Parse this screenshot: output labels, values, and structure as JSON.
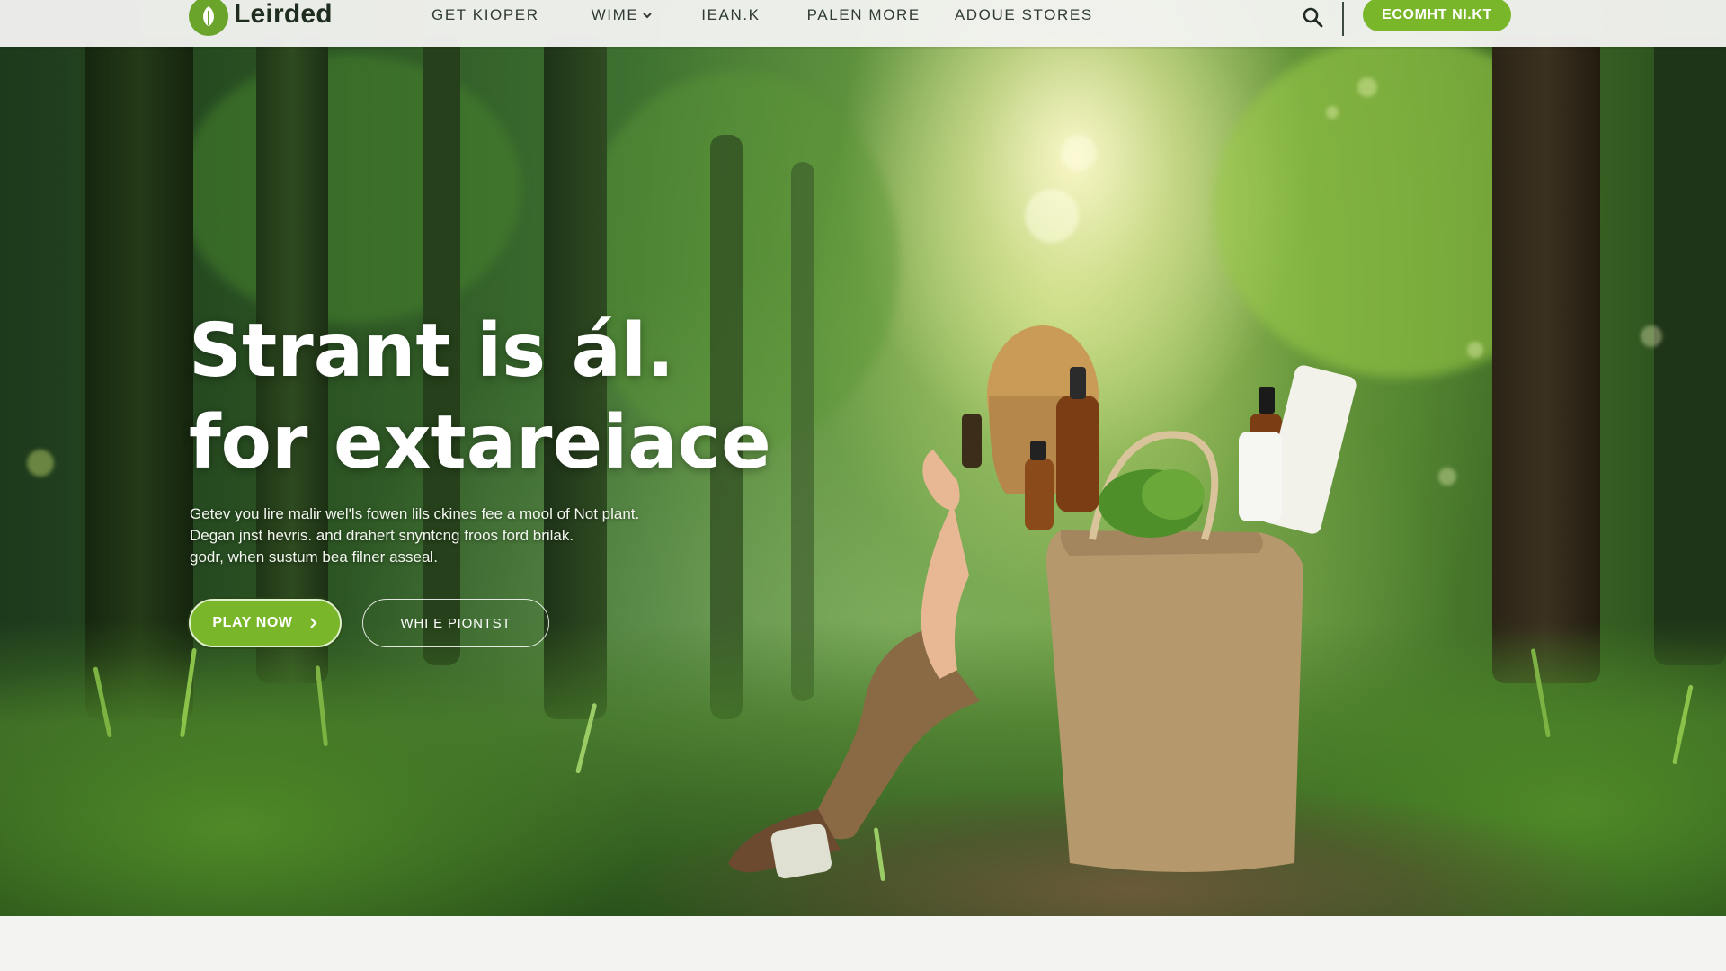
{
  "brand": {
    "name": "Leirded",
    "logo_icon": "leaf-icon",
    "accent_color": "#79b62a"
  },
  "nav": {
    "items": [
      {
        "label": "GET KIOPER",
        "has_dropdown": false
      },
      {
        "label": "WIME",
        "has_dropdown": true
      },
      {
        "label": "IEAN.K",
        "has_dropdown": false
      },
      {
        "label": "PALEN MORE",
        "has_dropdown": false
      },
      {
        "label": "ADOUE STORES",
        "has_dropdown": false
      }
    ],
    "search_icon": "search-icon",
    "cta_label": "ECOMHT NI.KT"
  },
  "hero": {
    "title_line1": "Strant is ál.",
    "title_line2": "for extareiace",
    "subtitle_lines": [
      "Getev you lire malir wel'ls fowen lils ckines fee a mool of Not plant.",
      "Degan jnst hevris. and drahert snyntcng froos ford brilak.",
      "godr, when sustum bea filner asseal."
    ],
    "primary_button": "PLAY NOW",
    "secondary_button": "WHI E PIONTST"
  }
}
